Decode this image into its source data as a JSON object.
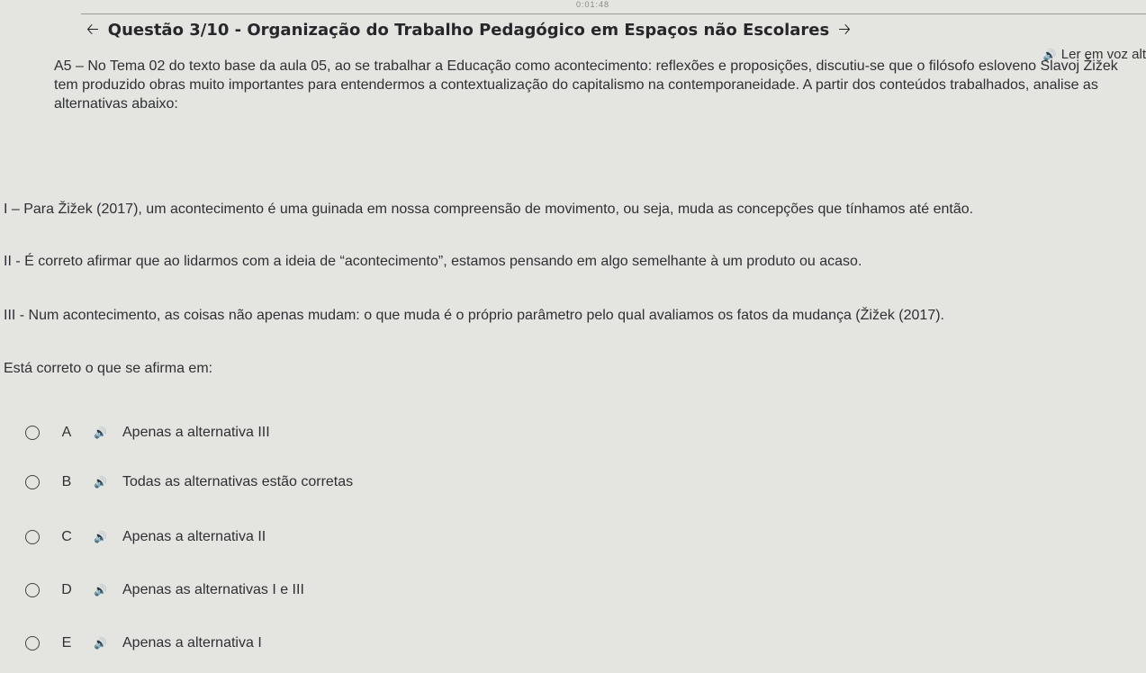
{
  "timer": "0:01:48",
  "header": {
    "title": "Questão 3/10 - Organização do Trabalho Pedagógico em Espaços não Escolares"
  },
  "tts": {
    "label": "Ler em voz alt"
  },
  "question": {
    "stem": "A5 – No Tema 02 do texto base da aula 05, ao se trabalhar a Educação como acontecimento: reflexões e proposições, discutiu-se que o filósofo esloveno Slavoj Žižek tem produzido obras muito importantes para entendermos a contextualização do capitalismo na contemporaneidade. A partir dos conteúdos trabalhados, analise as alternativas abaixo:",
    "statements": [
      "I – Para Žižek (2017), um acontecimento é uma guinada em nossa compreensão de movimento, ou seja, muda as concepções que tínhamos até então.",
      "II - É correto afirmar que ao lidarmos com a ideia de “acontecimento”, estamos pensando em algo semelhante à um produto ou acaso.",
      "III - Num acontecimento, as coisas não apenas mudam: o que muda é o próprio parâmetro pelo qual avaliamos os fatos da mudança (Žižek (2017)."
    ],
    "prompt": "Está correto o que se afirma em:"
  },
  "options": [
    {
      "letter": "A",
      "text": "Apenas a alternativa III"
    },
    {
      "letter": "B",
      "text": "Todas as alternativas estão corretas"
    },
    {
      "letter": "C",
      "text": "Apenas a alternativa II"
    },
    {
      "letter": "D",
      "text": "Apenas as alternativas I e III"
    },
    {
      "letter": "E",
      "text": "Apenas a alternativa I"
    }
  ],
  "icons": {
    "back": "arrow-left-icon",
    "next": "arrow-right-icon",
    "speaker": "speaker-icon"
  }
}
